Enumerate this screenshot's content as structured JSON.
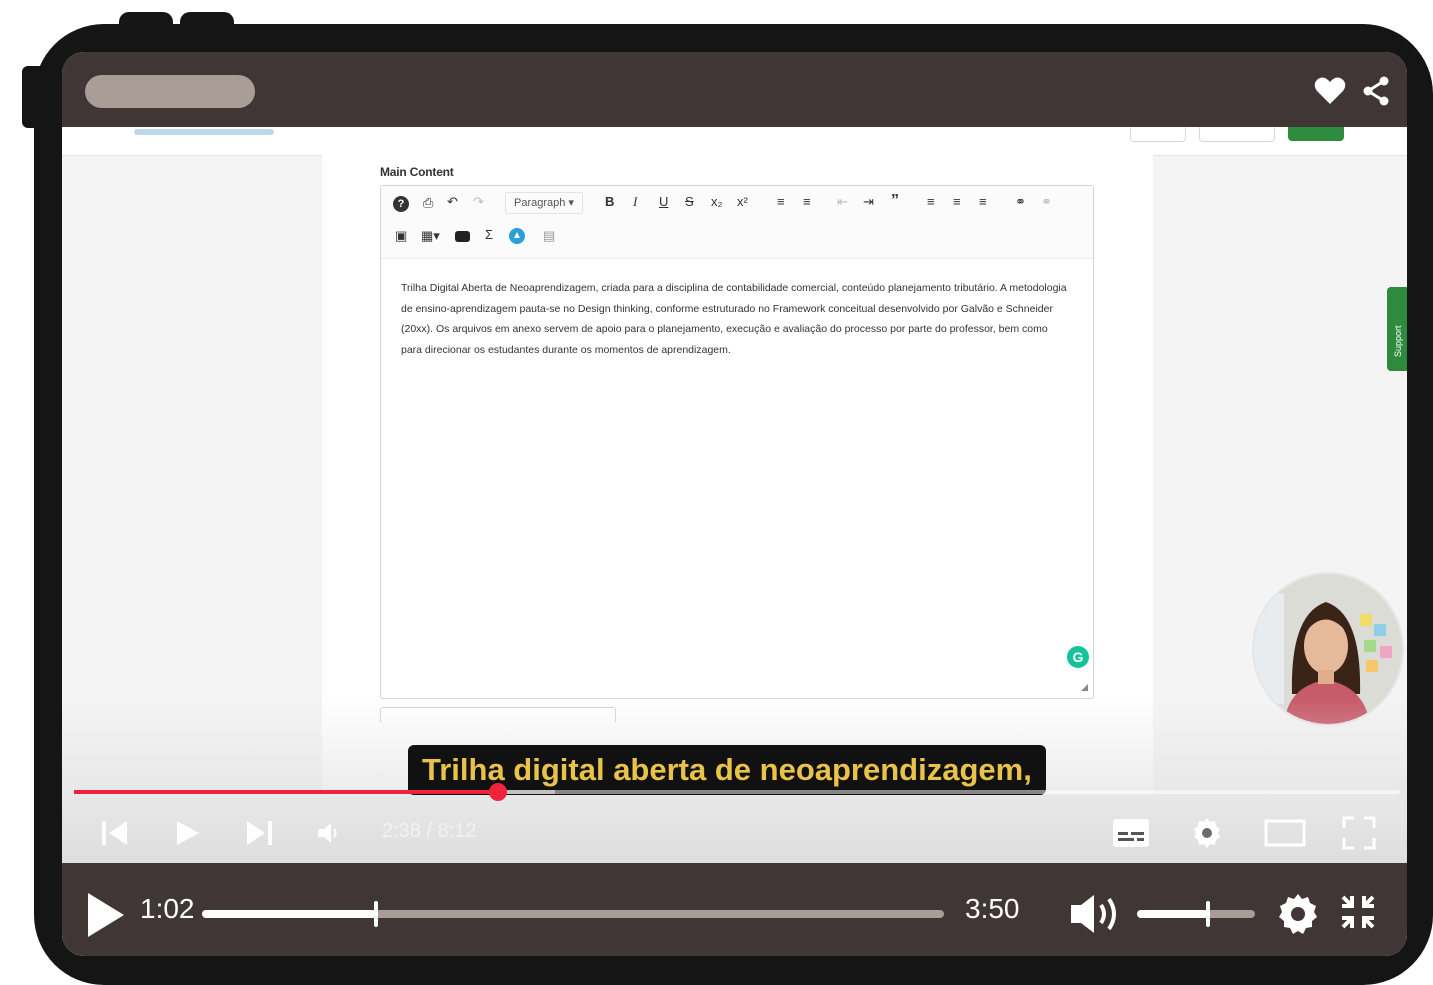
{
  "editor": {
    "section_label": "Main Content",
    "paragraph_dropdown": "Paragraph",
    "body_text": "Trilha Digital Aberta de Neoaprendizagem, criada para a disciplina de contabilidade comercial, conteúdo planejamento tributário. A metodologia de ensino-aprendizagem pauta-se no Design thinking, conforme estruturado no Framework conceitual desenvolvido por Galvão e Schneider (20xx). Os arquivos em anexo servem de apoio para o planejamento, execução e avaliação do processo por parte do professor, bem como para direcionar os estudantes durante os momentos de aprendizagem."
  },
  "caption": "Trilha digital aberta de neoaprendizagem,",
  "youtube_player": {
    "time_display": "2:38 / 8:12",
    "progress": 0.32,
    "buffered": 0.363
  },
  "outer_player": {
    "current_time": "1:02",
    "duration": "3:50",
    "progress": 0.235,
    "volume": 0.6
  },
  "colors": {
    "bar_background": "#403636",
    "track": "#a89e97",
    "yt_red": "#f0233a",
    "caption_text": "#e9c24a",
    "support_green": "#2e8b3e"
  }
}
